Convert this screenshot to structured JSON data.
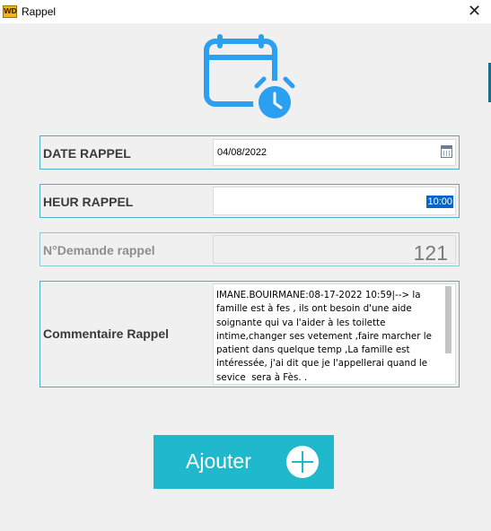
{
  "window": {
    "title": "Rappel",
    "app_icon_text": "WD",
    "close_icon": "close-icon"
  },
  "header_icon": "calendar-alarm-icon",
  "colors": {
    "accent": "#1fb8cc",
    "icon_blue": "#2b9ff0",
    "field_border": "#4ab0c8",
    "selection": "#0a64c8"
  },
  "fields": {
    "date": {
      "label": "DATE RAPPEL",
      "value": "04/08/2022"
    },
    "time": {
      "label": "HEUR  RAPPEL",
      "value": "10:00"
    },
    "request_number": {
      "label": "N°Demande rappel",
      "value": "121"
    },
    "comment": {
      "label": "Commentaire Rappel",
      "value": "IMANE.BOUIRMANE:08-17-2022 10:59|--> la famille est à fes , ils ont besoin d'une aide soignante qui va l'aider à les toilette intime,changer ses vetement ,faire marcher le patient dans quelque temp ,La famille est intéressée, j'ai dit que je l'appellerai quand le sevice  sera à Fès. .\nDonc la demande pou ce moment est perdu dans"
    }
  },
  "actions": {
    "add_label": "Ajouter"
  }
}
